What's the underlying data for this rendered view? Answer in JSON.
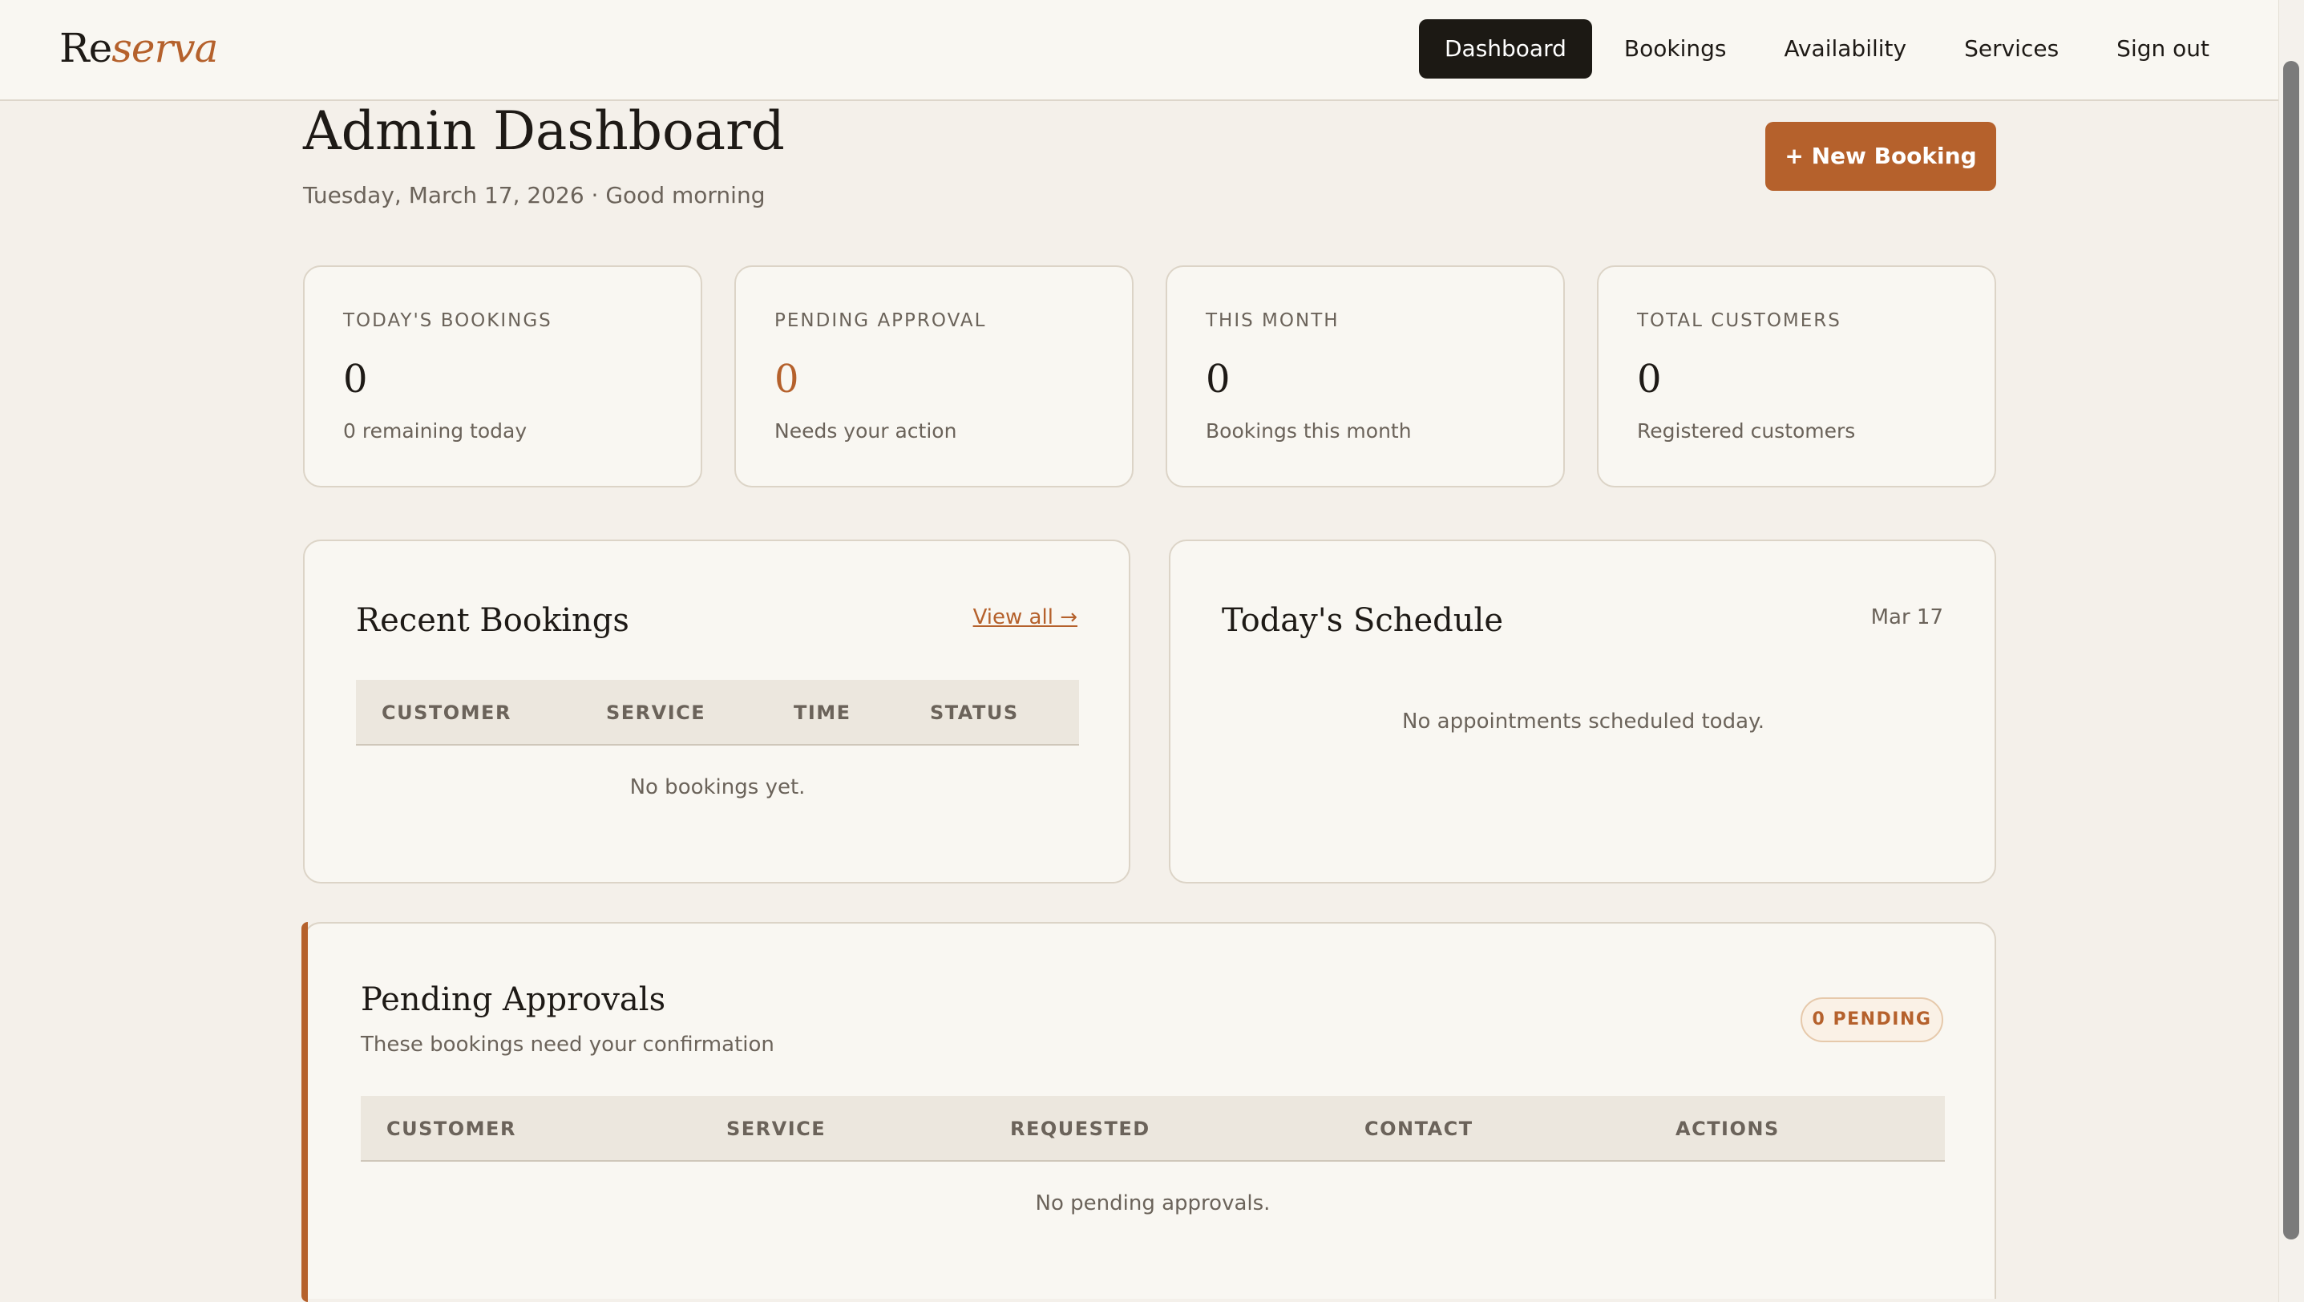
{
  "app": {
    "logo_a": "Re",
    "logo_b": "serva"
  },
  "nav": {
    "items": [
      "Dashboard",
      "Bookings",
      "Availability",
      "Services",
      "Sign out"
    ],
    "active": "Dashboard"
  },
  "header": {
    "title": "Admin Dashboard",
    "subtitle": "Tuesday, March 17, 2026 · Good morning",
    "new_booking_label": "+ New Booking"
  },
  "stats": [
    {
      "label": "TODAY'S BOOKINGS",
      "value": "0",
      "caption": "0 remaining today"
    },
    {
      "label": "PENDING APPROVAL",
      "value": "0",
      "caption": "Needs your action"
    },
    {
      "label": "THIS MONTH",
      "value": "0",
      "caption": "Bookings this month"
    },
    {
      "label": "TOTAL CUSTOMERS",
      "value": "0",
      "caption": "Registered customers"
    }
  ],
  "recent_bookings": {
    "title": "Recent Bookings",
    "view_all": "View all →",
    "columns": [
      "CUSTOMER",
      "SERVICE",
      "TIME",
      "STATUS"
    ],
    "empty": "No bookings yet."
  },
  "schedule": {
    "title": "Today's Schedule",
    "date": "Mar 17",
    "empty": "No appointments scheduled today."
  },
  "pending": {
    "title": "Pending Approvals",
    "subtitle": "These bookings need your confirmation",
    "badge": "0 PENDING",
    "columns": [
      "CUSTOMER",
      "SERVICE",
      "REQUESTED",
      "CONTACT",
      "ACTIONS"
    ],
    "empty": "No pending approvals."
  },
  "colors": {
    "accent": "#b5612c",
    "nav_active_bg": "#1c1914",
    "page_bg": "#f4f0ea",
    "card_bg": "#f9f7f2"
  }
}
